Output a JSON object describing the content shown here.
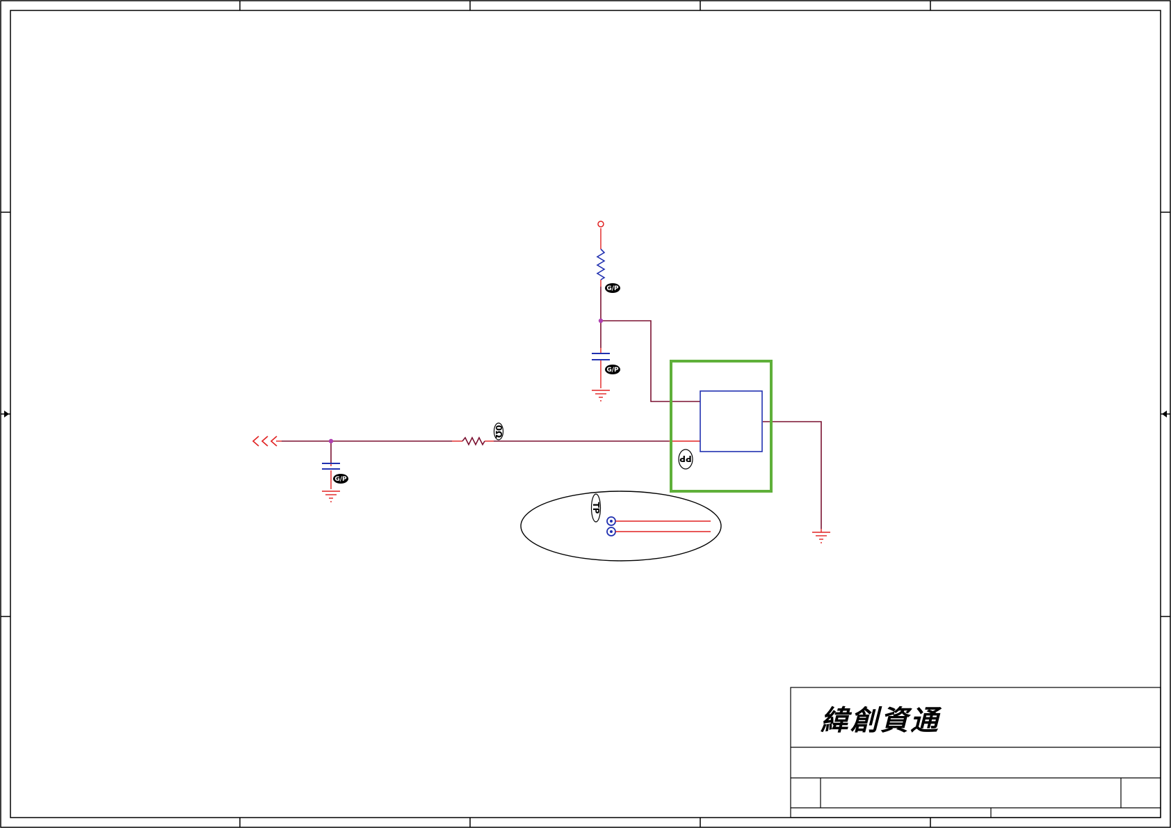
{
  "title_block": {
    "company_name": "緯創資通"
  },
  "annotations": {
    "gp_tag": "G/P",
    "r_tag": "0Ω",
    "ic_tag": "PP",
    "test_tag": "TP"
  },
  "colors": {
    "frame": "#000000",
    "wire": "#7a1030",
    "pin": "#e02020",
    "component": "#2030b0",
    "junction": "#b040b0",
    "highlight_box": "#5fb03a"
  }
}
